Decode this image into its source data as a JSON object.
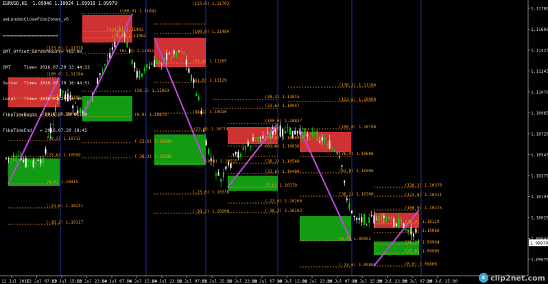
{
  "header": {
    "symbol_line": "EURUSD,H1  1.09946 1.10024 1.09918 1.09979",
    "info_lines": [
      "smLondonCloseFibo2ones_v6",
      "=====================",
      "GMT_Offset_ServerHours= +03:00",
      "GMT     Time= 2016.07.20 13:44:32",
      "Server  Time= 2016.07.20 16:44:51",
      "Local   Time= 2016.07.20 16:44",
      "FiboTimeBegin = 2016.07.20 01:00",
      "FiboTimeEnd   = 2016.07.20 18:45"
    ]
  },
  "price_axis": {
    "labels": [
      "1.11780",
      "1.11600",
      "1.11425",
      "1.11245",
      "1.11070",
      "1.10965",
      "1.10720",
      "1.10545",
      "1.10370",
      "1.10195",
      "1.10020",
      "1.09845",
      "1.09670"
    ],
    "current_price": "1.09979"
  },
  "time_axis": {
    "labels": [
      "12 Jul 2016",
      "13 Jul 07:00",
      "13 Jul 15:00",
      "13 Jul 23:00",
      "14 Jul 07:00",
      "14 Jul 15:00",
      "14 Jul 23:00",
      "15 Jul 07:00",
      "15 Jul 15:00",
      "15 Jul 23:00",
      "18 Jul 07:00",
      "18 Jul 15:00",
      "18 Jul 23:00",
      "19 Jul 07:00",
      "19 Jul 15:00",
      "19 Jul 23:00",
      "20 Jul 07:00",
      "20 Jul 15:00"
    ]
  },
  "fibo_labels": [
    [
      "(100.0) 1.11194",
      "(76.4) 1.11101",
      "(61.8) 1.10896",
      "(38.2) 1.10713",
      "(23.6) 1.10599",
      "(0.0) 1.10415",
      "(-23.6) 1.10231",
      "(-38.2) 1.10117",
      "(123.6) 1.11378"
    ],
    [
      "(100.0) 1.11642",
      "(76.4) 1.11462",
      "(61.8) 1.11351",
      "(123.6) 1.11492",
      "(38.2) 1.11059",
      "(0.0) 1.10879",
      "(-23.6) 1.10699",
      "(-38.2) 1.10588"
    ],
    [
      "(123.6) 1.11703",
      "(100.0) 1.11484",
      "(76.4) 1.11265",
      "(61.8) 1.11129",
      "(38.2) 1.10910",
      "(23.6) 1.10774",
      "(0.0) 1.10555",
      "(-23.6) 1.10336",
      "(-38.2) 1.10200"
    ],
    [
      "(38.2) 1.11015",
      "(23.6) 1.10947",
      "(100.0) 1.10837",
      "(76.4) 1.10689",
      "(61.8) 1.10636",
      "(38.2) 1.10548",
      "(23.6) 1.10480",
      "(0.0) 1.10370",
      "(-23.6) 1.10260",
      "(-38.2) 1.10192"
    ],
    [
      "(138.2) 1.11106",
      "(123.6) 1.10988",
      "(100.0) 1.10798",
      "(76.4) 1.10608",
      "(61.8) 1.10490",
      "(38.2) 1.10300",
      "(0.0) 1.09992",
      "(-23.6) 1.09802"
    ],
    [
      "(138.2) 1.10370",
      "(123.6) 1.10311",
      "(100.0) 1.10215",
      "(76.4) 1.10119",
      "(61.8) 1.10060",
      "(38.2) 1.09964",
      "(23.6) 1.09905",
      "(0.0) 1.09809"
    ]
  ],
  "colors": {
    "background": "#000000",
    "bull_candle": "#00dd00",
    "bear_candle": "#ffffff",
    "upper_zone": "#d93535",
    "lower_zone": "#15a315",
    "fibo_line": "#ff9a1a",
    "diagonal": "#b64bd8",
    "session_line": "#2233aa",
    "axis": "#8a8a8a",
    "price_tag_bg": "#ffffff"
  },
  "watermark": {
    "icon_text": "c",
    "text": "clip2net.com"
  }
}
